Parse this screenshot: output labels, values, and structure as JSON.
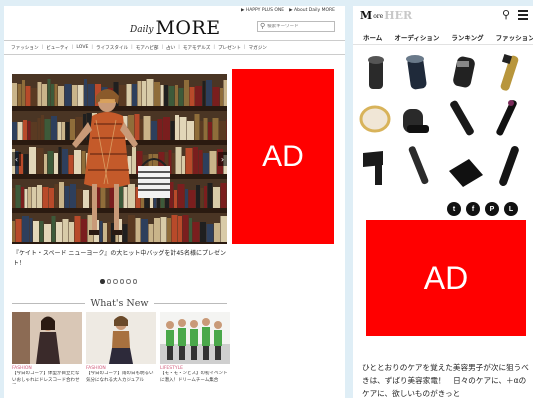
{
  "left": {
    "top_links": [
      "▶ HAPPY PLUS ONE",
      "▶ About Daily MORE"
    ],
    "logo_script": "Daily",
    "logo_main": "MORE",
    "search_placeholder": "検索キーワード",
    "nav": [
      "ファッション",
      "ビューティ",
      "LOVE",
      "ライフスタイル",
      "モアハピ部",
      "占い",
      "モアモデルズ",
      "プレゼント",
      "マガジン"
    ],
    "ad_label": "AD",
    "hero_caption": "『ケイト・スペード ニューヨーク』の大ヒット中バッグを計45名様にプレゼント！",
    "carousel_total": 6,
    "carousel_active": 1,
    "whats_new": "What's New",
    "articles": [
      {
        "category": "FASHION",
        "title": "【今日のコーデ】体型が目立たないおしゃれにドレスコード合わせて"
      },
      {
        "category": "FASHION",
        "title": "【今日のコーデ】雨の日も明るい気分になれる大人カジュアル"
      },
      {
        "category": "LIFESTYLE",
        "title": "【モ・モ・ンとス】の初イベントに潜入！ドリームチーム集合"
      }
    ],
    "colors": {
      "ad": "#ff0000",
      "category": "#d05a7a",
      "background": "#dfeef6"
    }
  },
  "right": {
    "logo": [
      "M",
      "ore",
      "HER"
    ],
    "search_icon": "search-icon",
    "menu_icon": "hamburger-menu-icon",
    "nav": [
      "ホーム",
      "オーディション",
      "ランキング",
      "ファッション"
    ],
    "share": [
      {
        "name": "twitter-icon",
        "glyph": "t"
      },
      {
        "name": "facebook-icon",
        "glyph": "f"
      },
      {
        "name": "pinterest-icon",
        "glyph": "P"
      },
      {
        "name": "line-icon",
        "glyph": "L"
      }
    ],
    "ad_label": "AD",
    "article_text": "ひととおりのケアを覚えた美容男子が次に狙うべきは、ずばり美容家電！　日々のケアに、＋αのケアに、欲しいものがきっと"
  }
}
